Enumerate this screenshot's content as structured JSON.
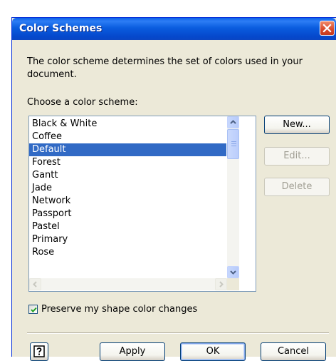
{
  "window": {
    "title": "Color Schemes"
  },
  "description": "The color scheme determines the set of colors used in your document.",
  "list": {
    "label": "Choose a color scheme:",
    "items": [
      {
        "label": "Black & White"
      },
      {
        "label": "Coffee"
      },
      {
        "label": "Default",
        "selected": true
      },
      {
        "label": "Forest"
      },
      {
        "label": "Gantt"
      },
      {
        "label": "Jade"
      },
      {
        "label": "Network"
      },
      {
        "label": "Passport"
      },
      {
        "label": "Pastel"
      },
      {
        "label": "Primary"
      },
      {
        "label": "Rose"
      }
    ]
  },
  "buttons": {
    "new": "New...",
    "edit": "Edit...",
    "delete": "Delete",
    "apply": "Apply",
    "ok": "OK",
    "cancel": "Cancel"
  },
  "checkbox": {
    "label": "Preserve my shape color changes",
    "checked": true
  },
  "icons": {
    "close": "close-icon",
    "help": "help-question-icon",
    "check": "checkmark-icon"
  },
  "colors": {
    "titlebar": "#0a5ddf",
    "selection": "#316ac5",
    "dialog_bg": "#ece9d8",
    "close_button": "#d8482a"
  }
}
